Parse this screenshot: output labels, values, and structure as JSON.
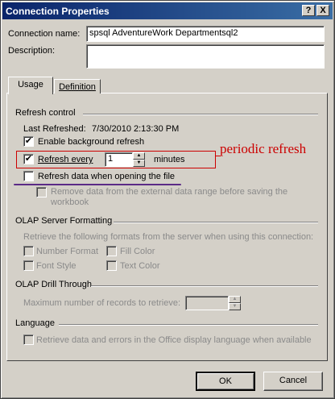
{
  "window": {
    "title": "Connection Properties",
    "help_glyph": "?",
    "close_glyph": "X"
  },
  "connection_name": {
    "label": "Connection name:",
    "value": "spsql AdventureWork Departmentsql2"
  },
  "description": {
    "label": "Description:",
    "value": ""
  },
  "tabs": [
    {
      "label": "Usage",
      "selected": true
    },
    {
      "label": "Definition",
      "selected": false
    }
  ],
  "refresh_control": {
    "section": "Refresh control",
    "last_refreshed_label": "Last Refreshed:",
    "last_refreshed_value": "7/30/2010  2:13:30 PM",
    "background_refresh": {
      "label": "Enable background refresh",
      "checked": true
    },
    "refresh_every": {
      "label": "Refresh every",
      "checked": true,
      "value": "1",
      "unit": "minutes"
    },
    "refresh_on_open": {
      "label": "Refresh data when opening the file",
      "checked": false
    },
    "remove_data": {
      "label": "Remove data from the external data range before saving the workbook",
      "checked": false
    }
  },
  "annotation": {
    "text": "periodic refresh",
    "color": "#cc0000",
    "underline_color": "#5b2a86"
  },
  "olap_formatting": {
    "section": "OLAP Server Formatting",
    "intro": "Retrieve the following formats from the server when using this connection:",
    "options": [
      {
        "label": "Number Format",
        "checked": false
      },
      {
        "label": "Fill Color",
        "checked": false
      },
      {
        "label": "Font Style",
        "checked": false
      },
      {
        "label": "Text Color",
        "checked": false
      }
    ]
  },
  "olap_drill": {
    "section": "OLAP Drill Through",
    "max_records_label": "Maximum number of records to retrieve:",
    "max_records_value": ""
  },
  "language": {
    "section": "Language",
    "retrieve_label": "Retrieve data and errors in the Office display language when available",
    "checked": false
  },
  "buttons": {
    "ok": "OK",
    "cancel": "Cancel"
  },
  "glyphs": {
    "check": "✔",
    "spin_up": "▲",
    "spin_down": "▼"
  }
}
